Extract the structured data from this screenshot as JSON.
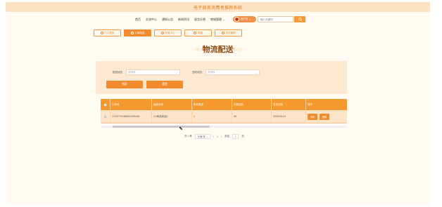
{
  "app": {
    "title": "电子商务消费者推荐系统"
  },
  "nav": {
    "links": [
      "首页",
      "交流中心",
      "通知公告",
      "新闻资讯",
      "留言反馈",
      "商城管理"
    ],
    "user_name": "用户名",
    "search_placeholder": "输入关键词",
    "search_icon": "search-icon"
  },
  "tabs": [
    {
      "label": "个人首页",
      "active": false
    },
    {
      "label": "订单配送",
      "active": true
    },
    {
      "label": "充值中心",
      "active": false
    },
    {
      "label": "收藏",
      "active": false
    },
    {
      "label": "评论管理",
      "active": false
    }
  ],
  "page": {
    "title": "物流配送",
    "title_bg_left": "festi",
    "title_bg_right": "dity"
  },
  "filters": {
    "status_label": "配送状态",
    "status_placeholder": "请选择",
    "receipt_label": "签收状态",
    "receipt_placeholder": "请选择",
    "search_btn": "搜索",
    "reset_btn": "重置"
  },
  "table": {
    "columns": [
      "订单号",
      "商品名称",
      "购买数量",
      "总配送费",
      "发货日期",
      "操作"
    ],
    "rows": [
      {
        "order_no": "17437791356601225446",
        "product": "XX商品商品1",
        "qty": "1",
        "fee": "96",
        "date": "2025-03-24",
        "actions": [
          "详情",
          "删除"
        ]
      }
    ]
  },
  "pagination": {
    "total": "共 1 条",
    "page_size": "10条/页",
    "current_page": "1",
    "goto_label": "前往",
    "goto_value": "1",
    "page_unit": "页"
  },
  "colors": {
    "accent": "#f28b2c",
    "header_bg": "#fde3c4",
    "panel_bg": "#fde9d2"
  }
}
